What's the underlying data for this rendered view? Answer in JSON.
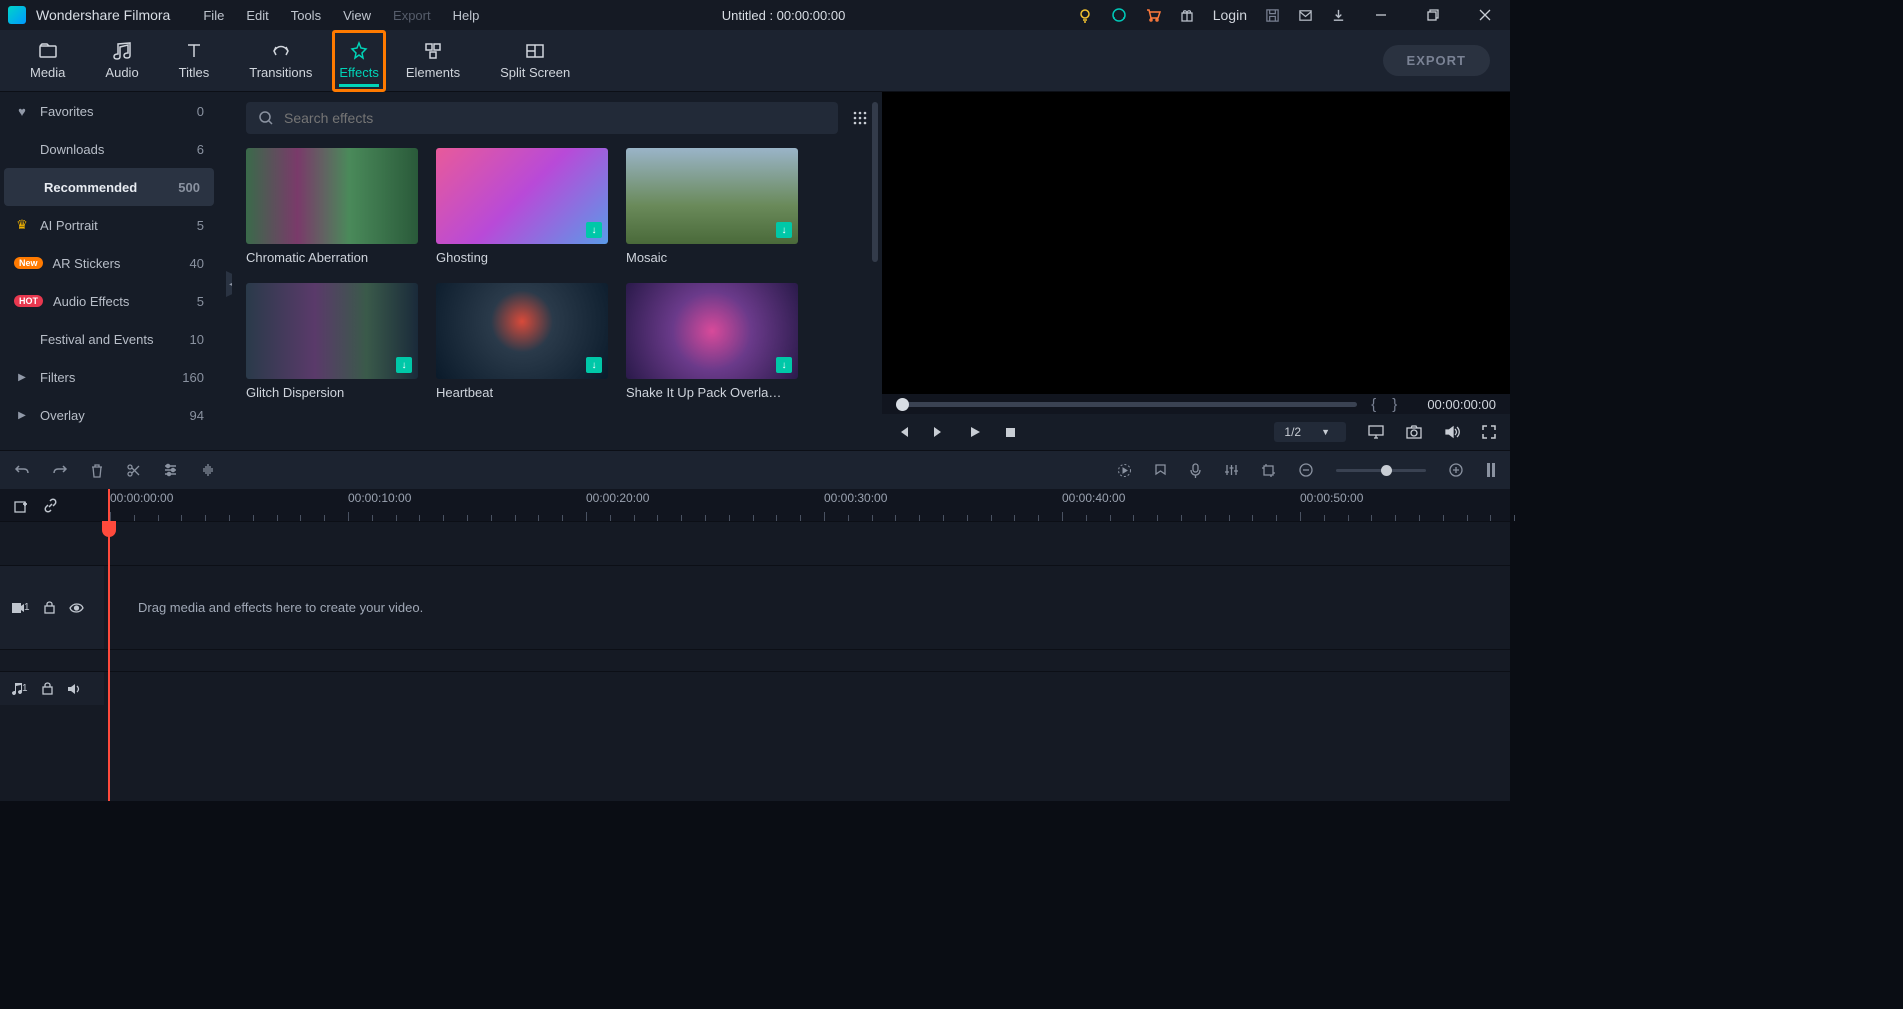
{
  "app": {
    "title": "Wondershare Filmora",
    "doc": "Untitled : 00:00:00:00",
    "login": "Login"
  },
  "menu": [
    "File",
    "Edit",
    "Tools",
    "View",
    "Export",
    "Help"
  ],
  "menu_disabled": [
    4
  ],
  "tabs": [
    {
      "label": "Media",
      "icon": "folder"
    },
    {
      "label": "Audio",
      "icon": "audio"
    },
    {
      "label": "Titles",
      "icon": "titles"
    },
    {
      "label": "Transitions",
      "icon": "transitions"
    },
    {
      "label": "Effects",
      "icon": "effects"
    },
    {
      "label": "Elements",
      "icon": "elements"
    },
    {
      "label": "Split Screen",
      "icon": "split"
    }
  ],
  "active_tab": 4,
  "export_label": "EXPORT",
  "sidebar": [
    {
      "icon": "heart",
      "label": "Favorites",
      "count": "0"
    },
    {
      "icon": "",
      "label": "Downloads",
      "count": "6"
    },
    {
      "icon": "",
      "label": "Recommended",
      "count": "500",
      "selected": true
    },
    {
      "icon": "crown",
      "label": "AI Portrait",
      "count": "5"
    },
    {
      "icon": "new",
      "label": "AR Stickers",
      "count": "40"
    },
    {
      "icon": "hot",
      "label": "Audio Effects",
      "count": "5"
    },
    {
      "icon": "",
      "label": "Festival and Events",
      "count": "10"
    },
    {
      "icon": "arrow",
      "label": "Filters",
      "count": "160"
    },
    {
      "icon": "arrow",
      "label": "Overlay",
      "count": "94"
    }
  ],
  "search": {
    "placeholder": "Search effects"
  },
  "effects": [
    {
      "name": "Chromatic Aberration",
      "dl": false,
      "bg": "linear-gradient(90deg,#3a6a4a 0%,#7a3a6a 30%,#4a8a5a 60%,#2a5a3a 100%)"
    },
    {
      "name": "Ghosting",
      "dl": true,
      "bg": "linear-gradient(135deg,#e85a9a 0%,#b84ad8 50%,#5a9ae8 100%)"
    },
    {
      "name": "Mosaic",
      "dl": true,
      "bg": "linear-gradient(180deg,#9ab4c8 0%,#6a8a5a 60%,#4a6a3a 100%)"
    },
    {
      "name": "Glitch Dispersion",
      "dl": true,
      "bg": "linear-gradient(90deg,#2a3a4a 0%,#5a3a6a 40%,#3a5a4a 70%,#1a2a3a 100%)"
    },
    {
      "name": "Heartbeat",
      "dl": true,
      "bg": "radial-gradient(circle at 50% 40%,#d84a3a 0%,#2a3a4a 30%,#0a1a2a 100%)"
    },
    {
      "name": "Shake It Up Pack Overla…",
      "dl": true,
      "bg": "radial-gradient(circle,#d84a9a 0%,#6a3a8a 40%,#2a1a4a 100%)"
    }
  ],
  "preview": {
    "braces": "{     }",
    "time": "00:00:00:00",
    "ratio": "1/2"
  },
  "ruler": [
    "00:00:00:00",
    "00:00:10:00",
    "00:00:20:00",
    "00:00:30:00",
    "00:00:40:00",
    "00:00:50:00"
  ],
  "timeline": {
    "hint": "Drag media and effects here to create your video.",
    "video_label": "1",
    "audio_label": "1"
  }
}
